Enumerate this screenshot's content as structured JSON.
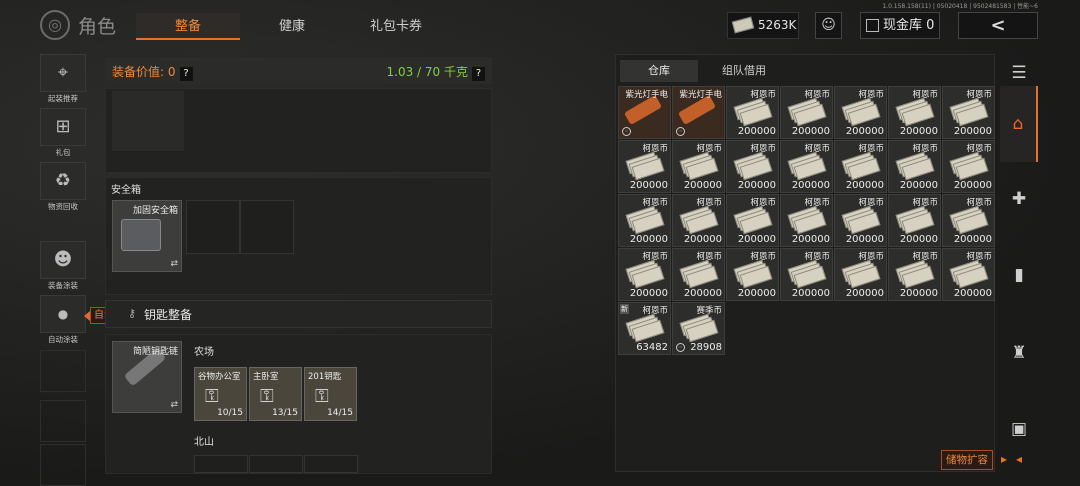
{
  "header": {
    "title": "角色",
    "tabs": [
      {
        "label": "整备",
        "active": true
      },
      {
        "label": "健康",
        "active": false
      },
      {
        "label": "礼包卡券",
        "active": false
      }
    ],
    "version": "1.0.158.158(11) | 05020418 | 9502481583 | 性能~6",
    "cash": "5263K",
    "vault": "现金库 0",
    "back": "<"
  },
  "sidebar": {
    "items": [
      {
        "label": "起装推荐",
        "icon": "loadout-icon"
      },
      {
        "label": "礼包",
        "icon": "gift-icon"
      },
      {
        "label": "物资回收",
        "icon": "recycle-icon"
      },
      {
        "label": "装备涂装",
        "icon": "paint-icon"
      },
      {
        "label": "自动涂装",
        "icon": "toggle-icon"
      }
    ],
    "auto_tip": "自动涂装"
  },
  "loadout": {
    "value_label": "装备价值: 0",
    "help": "?",
    "weight": "1.03 / 70 千克",
    "secure_box": {
      "title": "安全箱",
      "item": "加固安全箱",
      "swap": "⇄"
    },
    "key_bar_label": "钥匙整备",
    "key_section": {
      "item": "简陋钥匙链",
      "swap": "⇄",
      "map1": "农场",
      "keys": [
        {
          "name": "谷物办公室",
          "count": "10/15"
        },
        {
          "name": "主卧室",
          "count": "13/15"
        },
        {
          "name": "201钥匙",
          "count": "14/15"
        }
      ],
      "map2": "北山"
    }
  },
  "storage": {
    "tabs": [
      {
        "label": "仓库",
        "active": true
      },
      {
        "label": "组队借用",
        "active": false
      }
    ],
    "rows": [
      [
        {
          "name": "紫光灯手电",
          "amount": "",
          "type": "torch"
        },
        {
          "name": "紫光灯手电",
          "amount": "",
          "type": "torch"
        },
        {
          "name": "柯恩币",
          "amount": "200000",
          "type": "money"
        },
        {
          "name": "柯恩币",
          "amount": "200000",
          "type": "money"
        },
        {
          "name": "柯恩币",
          "amount": "200000",
          "type": "money"
        },
        {
          "name": "柯恩币",
          "amount": "200000",
          "type": "money"
        },
        {
          "name": "柯恩币",
          "amount": "200000",
          "type": "money"
        }
      ],
      [
        {
          "name": "柯恩币",
          "amount": "200000",
          "type": "money"
        },
        {
          "name": "柯恩币",
          "amount": "200000",
          "type": "money"
        },
        {
          "name": "柯恩币",
          "amount": "200000",
          "type": "money"
        },
        {
          "name": "柯恩币",
          "amount": "200000",
          "type": "money"
        },
        {
          "name": "柯恩币",
          "amount": "200000",
          "type": "money"
        },
        {
          "name": "柯恩币",
          "amount": "200000",
          "type": "money"
        },
        {
          "name": "柯恩币",
          "amount": "200000",
          "type": "money"
        }
      ],
      [
        {
          "name": "柯恩币",
          "amount": "200000",
          "type": "money"
        },
        {
          "name": "柯恩币",
          "amount": "200000",
          "type": "money"
        },
        {
          "name": "柯恩币",
          "amount": "200000",
          "type": "money"
        },
        {
          "name": "柯恩币",
          "amount": "200000",
          "type": "money"
        },
        {
          "name": "柯恩币",
          "amount": "200000",
          "type": "money"
        },
        {
          "name": "柯恩币",
          "amount": "200000",
          "type": "money"
        },
        {
          "name": "柯恩币",
          "amount": "200000",
          "type": "money"
        }
      ],
      [
        {
          "name": "柯恩币",
          "amount": "200000",
          "type": "money"
        },
        {
          "name": "柯恩币",
          "amount": "200000",
          "type": "money"
        },
        {
          "name": "柯恩币",
          "amount": "200000",
          "type": "money"
        },
        {
          "name": "柯恩币",
          "amount": "200000",
          "type": "money"
        },
        {
          "name": "柯恩币",
          "amount": "200000",
          "type": "money"
        },
        {
          "name": "柯恩币",
          "amount": "200000",
          "type": "money"
        },
        {
          "name": "柯恩币",
          "amount": "200000",
          "type": "money"
        }
      ],
      [
        {
          "name": "柯恩币",
          "amount": "63482",
          "type": "money",
          "new": "新"
        },
        {
          "name": "赛季币",
          "amount": "28908",
          "type": "money"
        }
      ]
    ],
    "expand": "储物扩容"
  },
  "categories": [
    "filter-icon",
    "home-icon",
    "medkit-icon",
    "magazine-icon",
    "armor-icon",
    "box-icon"
  ]
}
